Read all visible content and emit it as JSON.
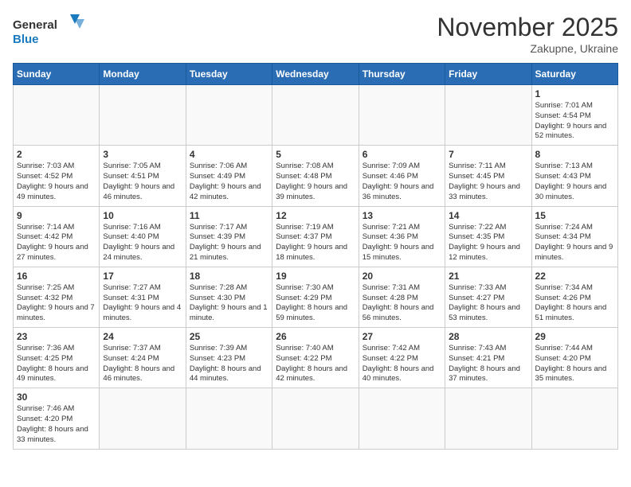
{
  "logo": {
    "text_general": "General",
    "text_blue": "Blue"
  },
  "title": {
    "month_year": "November 2025",
    "location": "Zakupne, Ukraine"
  },
  "days_of_week": [
    "Sunday",
    "Monday",
    "Tuesday",
    "Wednesday",
    "Thursday",
    "Friday",
    "Saturday"
  ],
  "weeks": [
    [
      {
        "day": "",
        "info": ""
      },
      {
        "day": "",
        "info": ""
      },
      {
        "day": "",
        "info": ""
      },
      {
        "day": "",
        "info": ""
      },
      {
        "day": "",
        "info": ""
      },
      {
        "day": "",
        "info": ""
      },
      {
        "day": "1",
        "info": "Sunrise: 7:01 AM\nSunset: 4:54 PM\nDaylight: 9 hours and 52 minutes."
      }
    ],
    [
      {
        "day": "2",
        "info": "Sunrise: 7:03 AM\nSunset: 4:52 PM\nDaylight: 9 hours and 49 minutes."
      },
      {
        "day": "3",
        "info": "Sunrise: 7:05 AM\nSunset: 4:51 PM\nDaylight: 9 hours and 46 minutes."
      },
      {
        "day": "4",
        "info": "Sunrise: 7:06 AM\nSunset: 4:49 PM\nDaylight: 9 hours and 42 minutes."
      },
      {
        "day": "5",
        "info": "Sunrise: 7:08 AM\nSunset: 4:48 PM\nDaylight: 9 hours and 39 minutes."
      },
      {
        "day": "6",
        "info": "Sunrise: 7:09 AM\nSunset: 4:46 PM\nDaylight: 9 hours and 36 minutes."
      },
      {
        "day": "7",
        "info": "Sunrise: 7:11 AM\nSunset: 4:45 PM\nDaylight: 9 hours and 33 minutes."
      },
      {
        "day": "8",
        "info": "Sunrise: 7:13 AM\nSunset: 4:43 PM\nDaylight: 9 hours and 30 minutes."
      }
    ],
    [
      {
        "day": "9",
        "info": "Sunrise: 7:14 AM\nSunset: 4:42 PM\nDaylight: 9 hours and 27 minutes."
      },
      {
        "day": "10",
        "info": "Sunrise: 7:16 AM\nSunset: 4:40 PM\nDaylight: 9 hours and 24 minutes."
      },
      {
        "day": "11",
        "info": "Sunrise: 7:17 AM\nSunset: 4:39 PM\nDaylight: 9 hours and 21 minutes."
      },
      {
        "day": "12",
        "info": "Sunrise: 7:19 AM\nSunset: 4:37 PM\nDaylight: 9 hours and 18 minutes."
      },
      {
        "day": "13",
        "info": "Sunrise: 7:21 AM\nSunset: 4:36 PM\nDaylight: 9 hours and 15 minutes."
      },
      {
        "day": "14",
        "info": "Sunrise: 7:22 AM\nSunset: 4:35 PM\nDaylight: 9 hours and 12 minutes."
      },
      {
        "day": "15",
        "info": "Sunrise: 7:24 AM\nSunset: 4:34 PM\nDaylight: 9 hours and 9 minutes."
      }
    ],
    [
      {
        "day": "16",
        "info": "Sunrise: 7:25 AM\nSunset: 4:32 PM\nDaylight: 9 hours and 7 minutes."
      },
      {
        "day": "17",
        "info": "Sunrise: 7:27 AM\nSunset: 4:31 PM\nDaylight: 9 hours and 4 minutes."
      },
      {
        "day": "18",
        "info": "Sunrise: 7:28 AM\nSunset: 4:30 PM\nDaylight: 9 hours and 1 minute."
      },
      {
        "day": "19",
        "info": "Sunrise: 7:30 AM\nSunset: 4:29 PM\nDaylight: 8 hours and 59 minutes."
      },
      {
        "day": "20",
        "info": "Sunrise: 7:31 AM\nSunset: 4:28 PM\nDaylight: 8 hours and 56 minutes."
      },
      {
        "day": "21",
        "info": "Sunrise: 7:33 AM\nSunset: 4:27 PM\nDaylight: 8 hours and 53 minutes."
      },
      {
        "day": "22",
        "info": "Sunrise: 7:34 AM\nSunset: 4:26 PM\nDaylight: 8 hours and 51 minutes."
      }
    ],
    [
      {
        "day": "23",
        "info": "Sunrise: 7:36 AM\nSunset: 4:25 PM\nDaylight: 8 hours and 49 minutes."
      },
      {
        "day": "24",
        "info": "Sunrise: 7:37 AM\nSunset: 4:24 PM\nDaylight: 8 hours and 46 minutes."
      },
      {
        "day": "25",
        "info": "Sunrise: 7:39 AM\nSunset: 4:23 PM\nDaylight: 8 hours and 44 minutes."
      },
      {
        "day": "26",
        "info": "Sunrise: 7:40 AM\nSunset: 4:22 PM\nDaylight: 8 hours and 42 minutes."
      },
      {
        "day": "27",
        "info": "Sunrise: 7:42 AM\nSunset: 4:22 PM\nDaylight: 8 hours and 40 minutes."
      },
      {
        "day": "28",
        "info": "Sunrise: 7:43 AM\nSunset: 4:21 PM\nDaylight: 8 hours and 37 minutes."
      },
      {
        "day": "29",
        "info": "Sunrise: 7:44 AM\nSunset: 4:20 PM\nDaylight: 8 hours and 35 minutes."
      }
    ],
    [
      {
        "day": "30",
        "info": "Sunrise: 7:46 AM\nSunset: 4:20 PM\nDaylight: 8 hours and 33 minutes."
      },
      {
        "day": "",
        "info": ""
      },
      {
        "day": "",
        "info": ""
      },
      {
        "day": "",
        "info": ""
      },
      {
        "day": "",
        "info": ""
      },
      {
        "day": "",
        "info": ""
      },
      {
        "day": "",
        "info": ""
      }
    ]
  ]
}
